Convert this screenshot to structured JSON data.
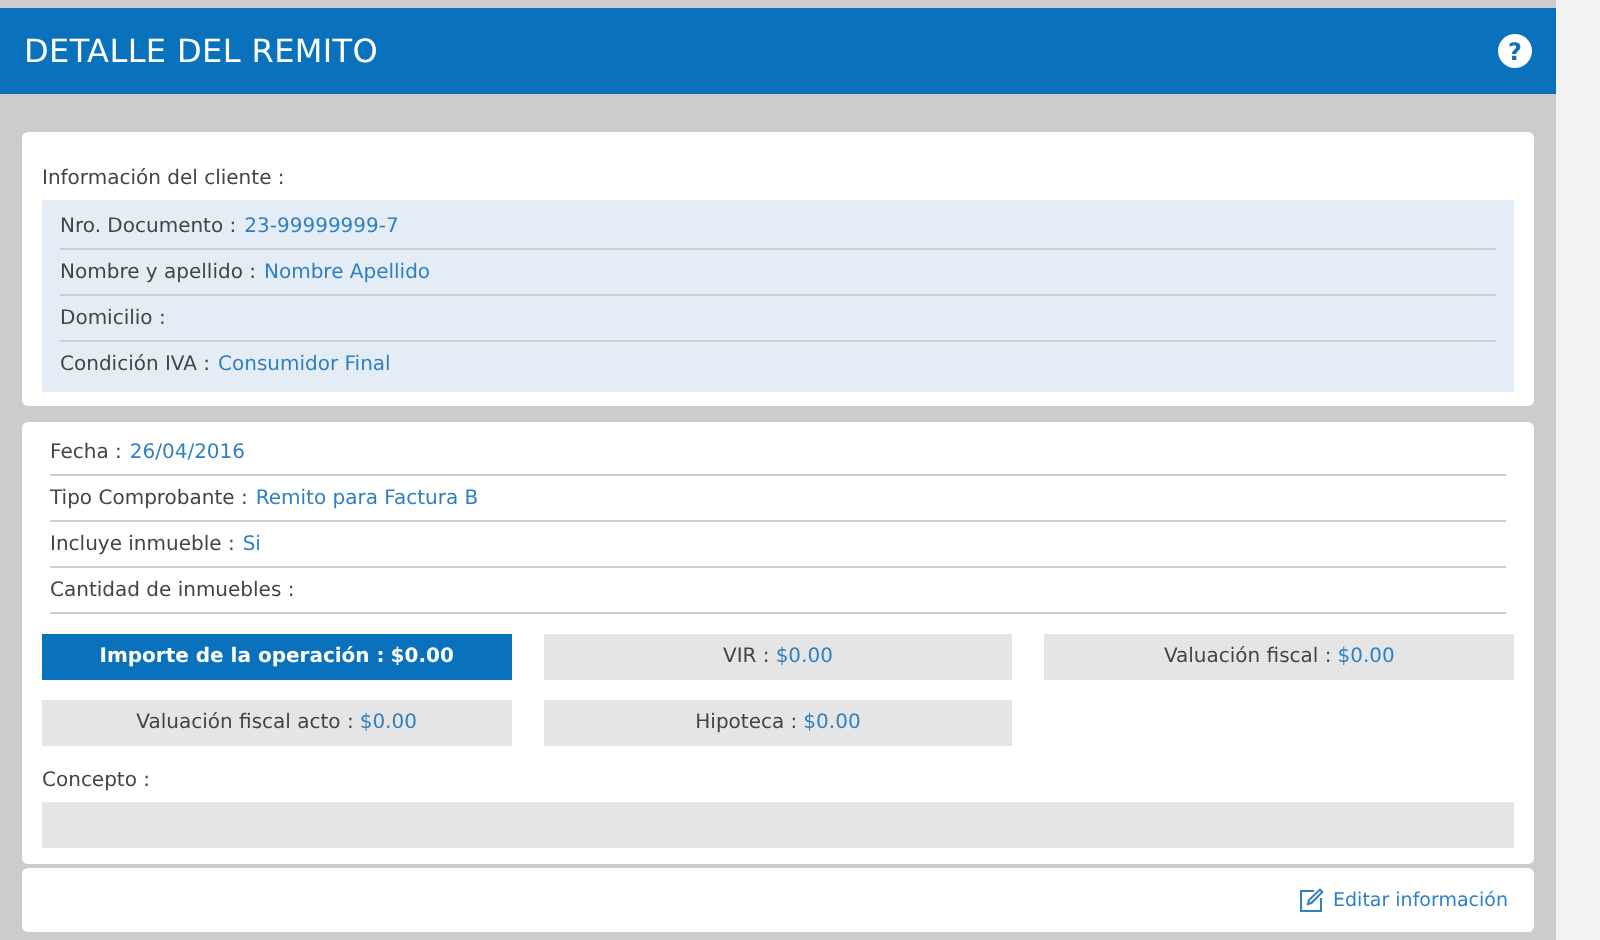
{
  "header": {
    "title": "DETALLE DEL REMITO",
    "help": "?"
  },
  "client": {
    "title": "Información del cliente :",
    "rows": [
      {
        "label": "Nro. Documento :",
        "value": "23-99999999-7"
      },
      {
        "label": "Nombre y apellido :",
        "value": "Nombre Apellido"
      },
      {
        "label": "Domicilio :"
      },
      {
        "label": "Condición IVA :",
        "value": "Consumidor Final"
      }
    ]
  },
  "details": {
    "rows": [
      {
        "label": "Fecha :",
        "value": "26/04/2016"
      },
      {
        "label": "Tipo Comprobante :",
        "value": "Remito para Factura B"
      },
      {
        "label": "Incluye inmueble :",
        "value": "Si"
      },
      {
        "label": "Cantidad de inmuebles :"
      }
    ],
    "amounts": [
      {
        "kind": "primary",
        "label": "Importe de la operación :",
        "value": "$0.00"
      },
      {
        "kind": "plain",
        "label": "VIR :",
        "value": "$0.00"
      },
      {
        "kind": "plain",
        "label": "Valuación fiscal :",
        "value": "$0.00"
      },
      {
        "kind": "plain",
        "label": "Valuación fiscal acto :",
        "value": "$0.00"
      },
      {
        "kind": "plain",
        "label": "Hipoteca :",
        "value": "$0.00"
      }
    ],
    "concept": {
      "label": "Concepto :"
    }
  },
  "footer": {
    "edit_link": "Editar información"
  }
}
